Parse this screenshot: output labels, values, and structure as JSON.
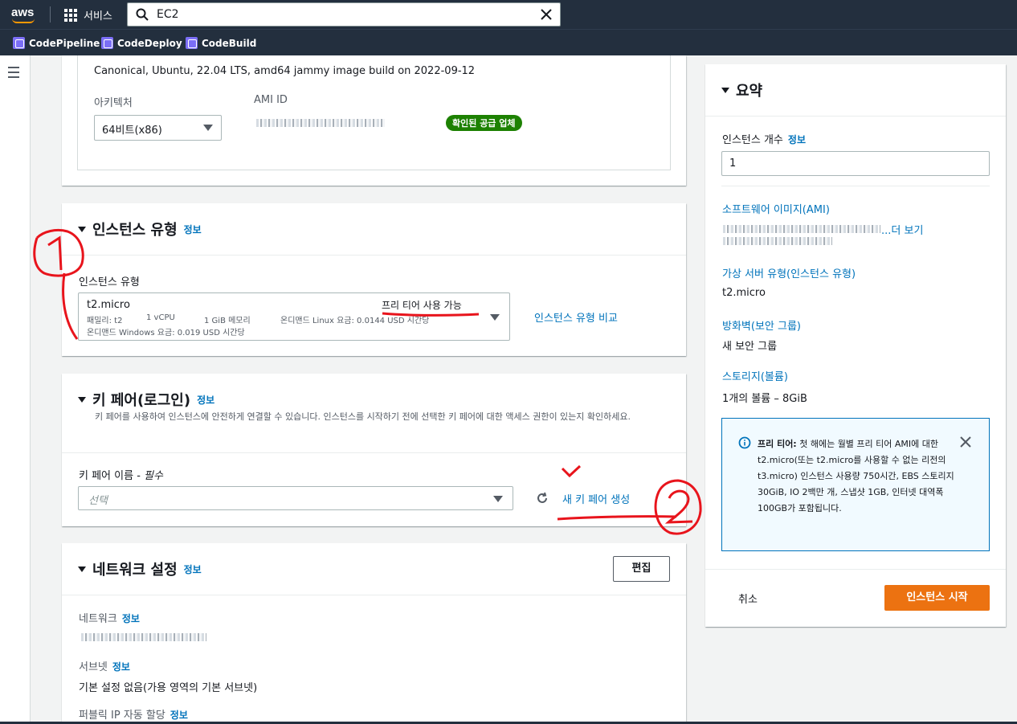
{
  "topnav": {
    "logo": "aws",
    "services_label": "서비스",
    "search_value": "EC2"
  },
  "favorites": [
    {
      "label": "CodePipeline",
      "icon": "codepipeline-icon"
    },
    {
      "label": "CodeDeploy",
      "icon": "codedeploy-icon"
    },
    {
      "label": "CodeBuild",
      "icon": "codebuild-icon"
    }
  ],
  "ami": {
    "description": "Canonical, Ubuntu, 22.04 LTS, amd64 jammy image build on 2022-09-12",
    "arch_label": "아키텍처",
    "arch_value": "64비트(x86)",
    "ami_id_label": "AMI ID",
    "verified_badge": "확인된 공급 업체"
  },
  "instance_type": {
    "title": "인스턴스 유형",
    "info": "정보",
    "field_label": "인스턴스 유형",
    "selected": "t2.micro",
    "free_tier": "프리 티어 사용 가능",
    "line1_family": "패밀리: t2",
    "line1_vcpu": "1 vCPU",
    "line1_mem": "1 GiB 메모리",
    "line1_linux": "온디맨드 Linux 요금: 0.0144 USD 시간당",
    "line2_windows": "온디맨드 Windows 요금: 0.019 USD 시간당",
    "compare_link": "인스턴스 유형 비교"
  },
  "key_pair": {
    "title": "키 페어(로그인)",
    "info": "정보",
    "description": "키 페어를 사용하여 인스턴스에 안전하게 연결할 수 있습니다. 인스턴스를 시작하기 전에 선택한 키 페어에 대한 액세스 권한이 있는지 확인하세요.",
    "field_label": "키 페어 이름 - ",
    "required": "필수",
    "placeholder": "선택",
    "create_link": "새 키 페어 생성"
  },
  "network": {
    "title": "네트워크 설정",
    "info": "정보",
    "edit_button": "편집",
    "network_label": "네트워크",
    "subnet_label": "서브넷",
    "subnet_value": "기본 설정 없음(가용 영역의 기본 서브넷)",
    "public_ip_label": "퍼블릭 IP 자동 할당"
  },
  "summary": {
    "title": "요약",
    "instance_count_label": "인스턴스 개수",
    "info": "정보",
    "instance_count_value": "1",
    "ami_label": "소프트웨어 이미지(AMI)",
    "ami_more": "...더 보기",
    "instance_type_label": "가상 서버 유형(인스턴스 유형)",
    "instance_type_value": "t2.micro",
    "firewall_label": "방화벽(보안 그룹)",
    "firewall_value": "새 보안 그룹",
    "storage_label": "스토리지(볼륨)",
    "storage_value": "1개의 볼륨 – 8GiB",
    "free_tier_title": "프리 티어:",
    "free_tier_text": " 첫 해에는 월별 프리 티어 AMI에 대한 t2.micro(또는 t2.micro를 사용할 수 없는 리전의 t3.micro) 인스턴스 사용량 750시간, EBS 스토리지 30GiB, IO 2백만 개, 스냅샷 1GB, 인터넷 대역폭 100GB가 포함됩니다.",
    "cancel": "취소",
    "launch": "인스턴스 시작"
  },
  "annotations": {
    "one": "1",
    "two": "2"
  },
  "colors": {
    "nav_bg": "#232f3e",
    "link": "#0073bb",
    "primary": "#ec7211",
    "verified": "#1d8102",
    "annotation": "#e8141c"
  }
}
